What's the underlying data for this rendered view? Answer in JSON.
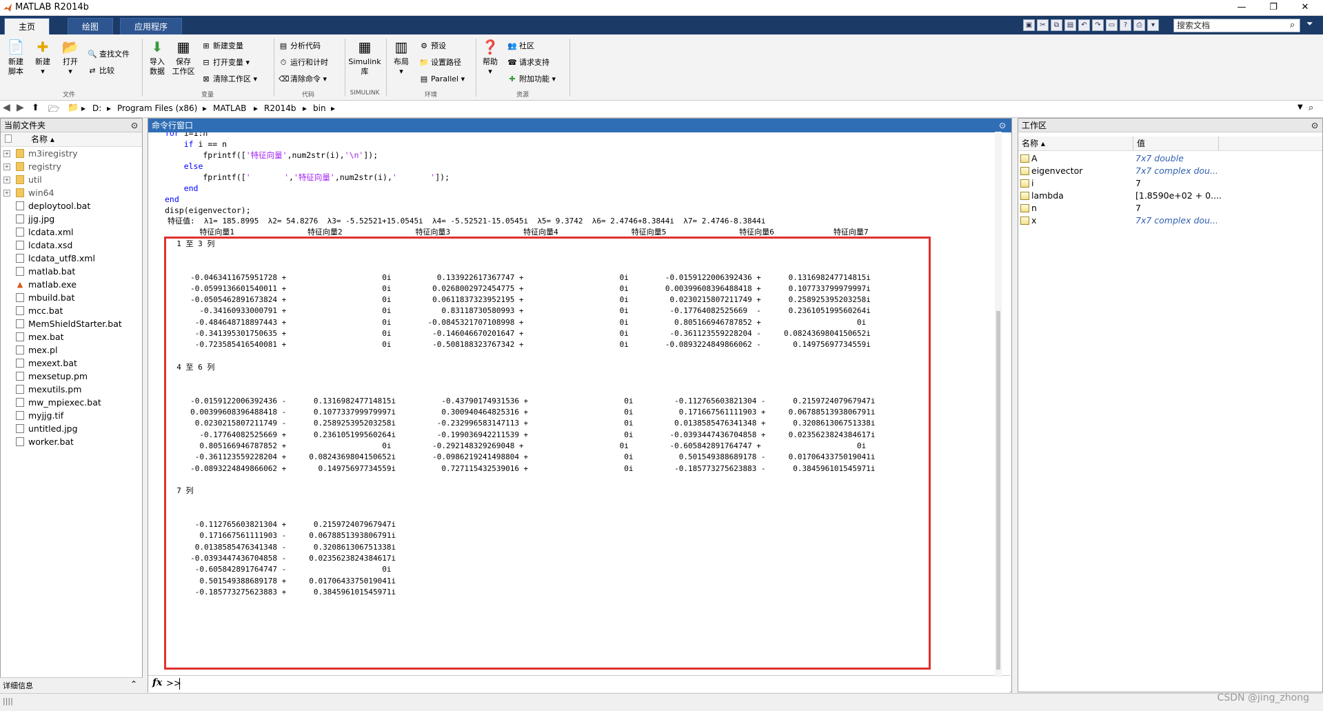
{
  "window": {
    "title": "MATLAB R2014b",
    "min_label": "—",
    "max_label": "❐",
    "close_label": "✕"
  },
  "tabs": [
    "主页",
    "绘图",
    "应用程序"
  ],
  "search": {
    "placeholder": "搜索文档"
  },
  "ribbon": {
    "new_script": "新建\n脚本",
    "new": "新建",
    "open": "打开",
    "find_files": "查找文件",
    "compare": "比较",
    "group_file": "文件",
    "import_data": "导入\n数据",
    "save_workspace": "保存\n工作区",
    "new_variable": "新建变量",
    "open_variable": "打开变量",
    "clear_workspace": "清除工作区",
    "group_variable": "变量",
    "analyze_code": "分析代码",
    "run_and_time": "运行和计时",
    "clear_commands": "清除命令",
    "group_code": "代码",
    "simulink": "Simulink\n库",
    "group_simulink": "SIMULINK",
    "layout": "布局",
    "preferences": "预设",
    "set_path": "设置路径",
    "parallel": "Parallel",
    "group_env": "环境",
    "help": "帮助",
    "community": "社区",
    "request_support": "请求支持",
    "add_ons": "附加功能",
    "group_resources": "资源"
  },
  "address": {
    "crumbs": [
      "D:",
      "Program Files (x86)",
      "MATLAB",
      "R2014b",
      "bin"
    ]
  },
  "file_panel": {
    "title": "当前文件夹",
    "name_col": "名称 ▴",
    "items": [
      {
        "name": "m3iregistry",
        "type": "folder"
      },
      {
        "name": "registry",
        "type": "folder"
      },
      {
        "name": "util",
        "type": "folder"
      },
      {
        "name": "win64",
        "type": "folder"
      },
      {
        "name": "deploytool.bat",
        "type": "file"
      },
      {
        "name": "jjg.jpg",
        "type": "file"
      },
      {
        "name": "lcdata.xml",
        "type": "file"
      },
      {
        "name": "lcdata.xsd",
        "type": "file"
      },
      {
        "name": "lcdata_utf8.xml",
        "type": "file"
      },
      {
        "name": "matlab.bat",
        "type": "file"
      },
      {
        "name": "matlab.exe",
        "type": "exe"
      },
      {
        "name": "mbuild.bat",
        "type": "file"
      },
      {
        "name": "mcc.bat",
        "type": "file"
      },
      {
        "name": "MemShieldStarter.bat",
        "type": "file"
      },
      {
        "name": "mex.bat",
        "type": "file"
      },
      {
        "name": "mex.pl",
        "type": "file"
      },
      {
        "name": "mexext.bat",
        "type": "file"
      },
      {
        "name": "mexsetup.pm",
        "type": "file"
      },
      {
        "name": "mexutils.pm",
        "type": "file"
      },
      {
        "name": "mw_mpiexec.bat",
        "type": "file"
      },
      {
        "name": "myjjg.tif",
        "type": "file"
      },
      {
        "name": "untitled.jpg",
        "type": "file"
      },
      {
        "name": "worker.bat",
        "type": "file"
      }
    ],
    "detail_label": "详细信息"
  },
  "command_window": {
    "title": "命令行窗口",
    "code": [
      "for i=1:n",
      "    if i == n",
      "        fprintf(['特征向量',num2str(i),'\\n']);",
      "    else",
      "        fprintf(['       ','特征向量',num2str(i),'       ']);",
      "    end",
      "end",
      "disp(eigenvector);"
    ],
    "output": [
      "特征值:  λ1= 185.8995  λ2= 54.8276  λ3= -5.52521+15.0545i  λ4= -5.52521-15.0545i  λ5= 9.3742  λ6= 2.4746+8.3844i  λ7= 2.4746-8.3844i",
      "       特征向量1                特征向量2                特征向量3                特征向量4                特征向量5                特征向量6             特征向量7",
      "  1 至 3 列",
      "",
      "",
      "     -0.0463411675951728 +                     0i          0.133922617367747 +                     0i        -0.0159122006392436 +      0.131698247714815i",
      "     -0.0599136601540011 +                     0i         0.0268002972454775 +                     0i        0.00399608396488418 +      0.107733799979997i",
      "     -0.0505462891673824 +                     0i         0.0611837323952195 +                     0i         0.0230215807211749 +      0.258925395203258i",
      "       -0.34160933000791 +                     0i           0.83118730580993 +                     0i         -0.17764082525669  -      0.236105199560264i",
      "      -0.484648718897443 +                     0i        -0.0845321707108998 +                     0i          0.805166946787852 +                     0i",
      "      -0.341395301750635 +                     0i         -0.146046670201647 +                     0i         -0.361123559228204 -     0.0824369804150652i",
      "      -0.723585416540081 +                     0i         -0.508188323767342 +                     0i        -0.0893224849866062 -       0.14975697734559i",
      "",
      "  4 至 6 列",
      "",
      "",
      "     -0.0159122006392436 -      0.131698247714815i          -0.43790174931536 +                     0i         -0.112765603821304 -      0.215972407967947i",
      "     0.00399608396488418 -      0.107733799979997i          0.300940464825316 +                     0i          0.171667561111903 +     0.0678851393806791i",
      "      0.0230215807211749 -      0.258925395203258i         -0.232996583147113 +                     0i         0.0138585476341348 +      0.320861306751338i",
      "       -0.17764082525669 +      0.236105199560264i         -0.199036942211539 +                     0i        -0.0393447436704858 +     0.0235623824384617i",
      "       0.805166946787852 +                     0i         -0.292148329269048 +                     0i         -0.605842891764747 +                     0i",
      "      -0.361123559228204 +     0.0824369804150652i        -0.0986219241498804 +                     0i          0.501549388689178 -     0.0170643375019041i",
      "     -0.0893224849866062 +       0.14975697734559i          0.727115432539016 +                     0i         -0.185773275623883 -      0.384596101545971i",
      "",
      "  7 列",
      "",
      "",
      "      -0.112765603821304 +      0.215972407967947i",
      "       0.171667561111903 -     0.0678851393806791i",
      "      0.0138585476341348 -      0.320861306751338i",
      "     -0.0393447436704858 -     0.0235623824384617i",
      "      -0.605842891764747 -                     0i",
      "       0.501549388689178 +     0.0170643375019041i",
      "      -0.185773275623883 +      0.384596101545971i"
    ],
    "prompt": "fx >>"
  },
  "workspace": {
    "title": "工作区",
    "name_col": "名称 ▴",
    "value_col": "值",
    "vars": [
      {
        "name": "A",
        "value": "7x7 double",
        "italic": true
      },
      {
        "name": "eigenvector",
        "value": "7x7 complex dou...",
        "italic": true
      },
      {
        "name": "i",
        "value": "7",
        "italic": false
      },
      {
        "name": "lambda",
        "value": "[1.8590e+02 + 0....",
        "italic": false
      },
      {
        "name": "n",
        "value": "7",
        "italic": false
      },
      {
        "name": "x",
        "value": "7x7 complex dou...",
        "italic": true
      }
    ]
  },
  "watermark": "CSDN @jing_zhong",
  "status": {
    "indicator": "||||"
  },
  "colors": {
    "tab_bar": "#1b3a66",
    "cmd_header": "#2f6db5",
    "highlight_box": "#e03030",
    "keyword": "#0000ff",
    "string": "#a020f0"
  }
}
